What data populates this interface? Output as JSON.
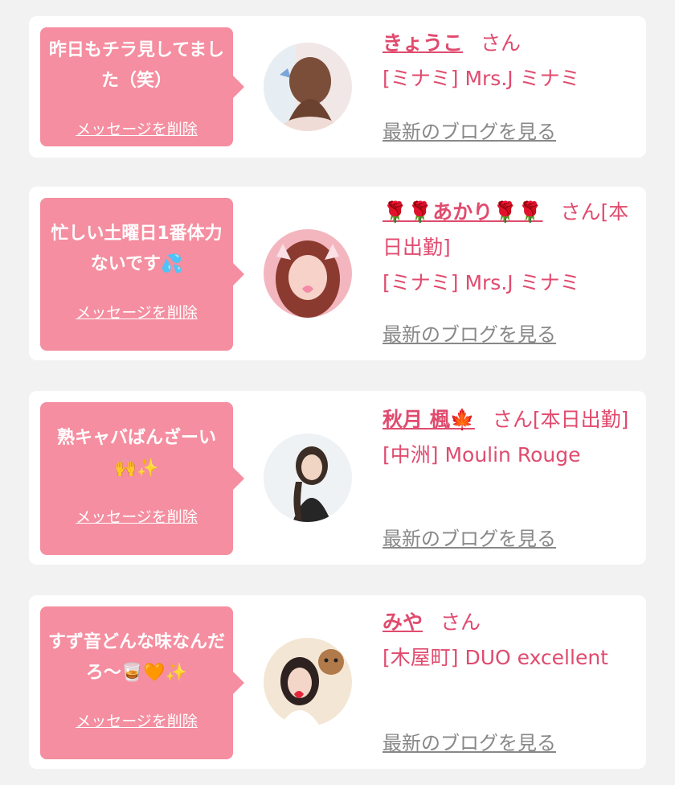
{
  "cards": [
    {
      "message": "昨日もチラ見してました（笑）",
      "delete_label": "メッセージを削除",
      "name": "きょうこ",
      "honorific": "さん",
      "shop": "[ミナミ] Mrs.J ミナミ",
      "blog_link": "最新のブログを見る"
    },
    {
      "message": "忙しい土曜日1番体力ないです💦",
      "delete_label": "メッセージを削除",
      "name": "🌹🌹あかり🌹🌹",
      "honorific": "さん[本日出勤]",
      "shop": "[ミナミ] Mrs.J ミナミ",
      "blog_link": "最新のブログを見る"
    },
    {
      "message": "熟キャバばんざーい🙌✨",
      "delete_label": "メッセージを削除",
      "name": "秋月 楓🍁",
      "honorific": "さん[本日出勤]",
      "shop": "[中洲] Moulin Rouge",
      "blog_link": "最新のブログを見る"
    },
    {
      "message": "すず音どんな味なんだろ〜🥃🧡✨",
      "delete_label": "メッセージを削除",
      "name": "みや",
      "honorific": "さん",
      "shop": "[木屋町] DUO excellent",
      "blog_link": "最新のブログを見る"
    }
  ],
  "colors": {
    "page_bg": "#f2f2f2",
    "bubble": "#f58ea0",
    "accent_text": "#e04b6e",
    "muted_link": "#888888"
  }
}
